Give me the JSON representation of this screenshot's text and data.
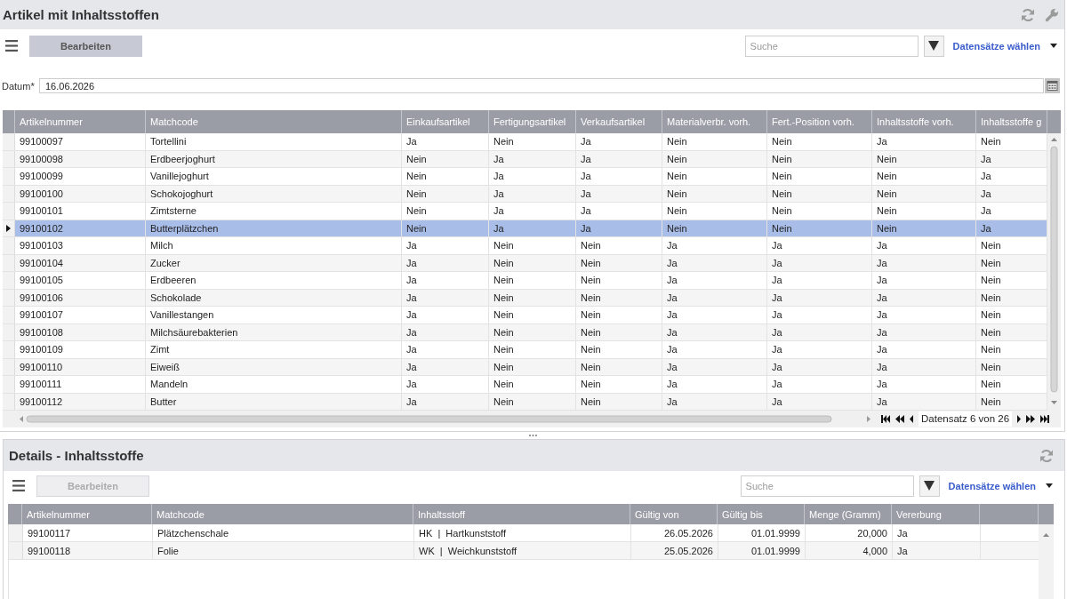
{
  "window": {
    "title": "Artikel mit Inhaltsstoffen"
  },
  "toolbar": {
    "edit_button": {
      "label": "Bearbeiten",
      "disabled": false
    },
    "search": {
      "placeholder": "Suche"
    },
    "records_menu": {
      "label": "Datensätze wählen"
    }
  },
  "date_field": {
    "label": "Datum*",
    "value": "16.06.2026"
  },
  "table": {
    "columns": [
      {
        "label": "Artikelnummer"
      },
      {
        "label": "Matchcode"
      },
      {
        "label": "Einkaufsartikel"
      },
      {
        "label": "Fertigungsartikel"
      },
      {
        "label": "Verkaufsartikel"
      },
      {
        "label": "Materialverbr. vorh."
      },
      {
        "label": "Fert.-Position vorh."
      },
      {
        "label": "Inhaltsstoffe vorh."
      },
      {
        "label": "Inhaltsstoffe g"
      }
    ],
    "rows": [
      {
        "selected": false,
        "cells": [
          "99100097",
          "Tortellini",
          "Ja",
          "Nein",
          "Ja",
          "Nein",
          "Nein",
          "Ja",
          "Nein"
        ]
      },
      {
        "selected": false,
        "cells": [
          "99100098",
          "Erdbeerjoghurt",
          "Nein",
          "Ja",
          "Ja",
          "Nein",
          "Nein",
          "Nein",
          "Ja"
        ]
      },
      {
        "selected": false,
        "cells": [
          "99100099",
          "Vanillejoghurt",
          "Nein",
          "Ja",
          "Ja",
          "Nein",
          "Nein",
          "Nein",
          "Ja"
        ]
      },
      {
        "selected": false,
        "cells": [
          "99100100",
          "Schokojoghurt",
          "Nein",
          "Ja",
          "Ja",
          "Nein",
          "Nein",
          "Nein",
          "Ja"
        ]
      },
      {
        "selected": false,
        "cells": [
          "99100101",
          "Zimtsterne",
          "Nein",
          "Ja",
          "Ja",
          "Nein",
          "Nein",
          "Nein",
          "Ja"
        ]
      },
      {
        "selected": true,
        "cells": [
          "99100102",
          "Butterplätzchen",
          "Nein",
          "Ja",
          "Ja",
          "Nein",
          "Nein",
          "Nein",
          "Ja"
        ]
      },
      {
        "selected": false,
        "cells": [
          "99100103",
          "Milch",
          "Ja",
          "Nein",
          "Nein",
          "Ja",
          "Ja",
          "Ja",
          "Nein"
        ]
      },
      {
        "selected": false,
        "cells": [
          "99100104",
          "Zucker",
          "Ja",
          "Nein",
          "Nein",
          "Ja",
          "Ja",
          "Ja",
          "Nein"
        ]
      },
      {
        "selected": false,
        "cells": [
          "99100105",
          "Erdbeeren",
          "Ja",
          "Nein",
          "Nein",
          "Ja",
          "Ja",
          "Ja",
          "Nein"
        ]
      },
      {
        "selected": false,
        "cells": [
          "99100106",
          "Schokolade",
          "Ja",
          "Nein",
          "Nein",
          "Ja",
          "Ja",
          "Ja",
          "Nein"
        ]
      },
      {
        "selected": false,
        "cells": [
          "99100107",
          "Vanillestangen",
          "Ja",
          "Nein",
          "Nein",
          "Ja",
          "Ja",
          "Ja",
          "Nein"
        ]
      },
      {
        "selected": false,
        "cells": [
          "99100108",
          "Milchsäurebakterien",
          "Ja",
          "Nein",
          "Nein",
          "Ja",
          "Ja",
          "Ja",
          "Nein"
        ]
      },
      {
        "selected": false,
        "cells": [
          "99100109",
          "Zimt",
          "Ja",
          "Nein",
          "Nein",
          "Ja",
          "Ja",
          "Ja",
          "Nein"
        ]
      },
      {
        "selected": false,
        "cells": [
          "99100110",
          "Eiweiß",
          "Ja",
          "Nein",
          "Nein",
          "Ja",
          "Ja",
          "Ja",
          "Nein"
        ]
      },
      {
        "selected": false,
        "cells": [
          "99100111",
          "Mandeln",
          "Ja",
          "Nein",
          "Nein",
          "Ja",
          "Ja",
          "Ja",
          "Nein"
        ]
      },
      {
        "selected": false,
        "cells": [
          "99100112",
          "Butter",
          "Ja",
          "Nein",
          "Nein",
          "Ja",
          "Ja",
          "Ja",
          "Nein"
        ]
      }
    ],
    "pager": {
      "text": "Datensatz 6 von 26"
    }
  },
  "details": {
    "title": "Details - Inhaltsstoffe",
    "toolbar": {
      "edit_button": {
        "label": "Bearbeiten",
        "disabled": true
      },
      "search": {
        "placeholder": "Suche"
      },
      "records_menu": {
        "label": "Datensätze wählen"
      }
    },
    "table": {
      "columns": [
        {
          "label": "Artikelnummer",
          "kind": "text"
        },
        {
          "label": "Matchcode",
          "kind": "text"
        },
        {
          "label": "Inhaltsstoff",
          "kind": "text"
        },
        {
          "label": "Gültig von",
          "kind": "date"
        },
        {
          "label": "Gültig bis",
          "kind": "date"
        },
        {
          "label": "Menge (Gramm)",
          "kind": "number"
        },
        {
          "label": "Vererbung",
          "kind": "text"
        }
      ],
      "rows": [
        {
          "selected": false,
          "cells": [
            "99100117",
            "Plätzchenschale",
            "HK  |  Hartkunststoff",
            "26.05.2026",
            "01.01.9999",
            "20,000",
            "Ja"
          ]
        },
        {
          "selected": false,
          "cells": [
            "99100118",
            "Folie",
            "WK  |  Weichkunststoff",
            "25.05.2026",
            "01.01.9999",
            "4,000",
            "Ja"
          ]
        }
      ]
    }
  }
}
